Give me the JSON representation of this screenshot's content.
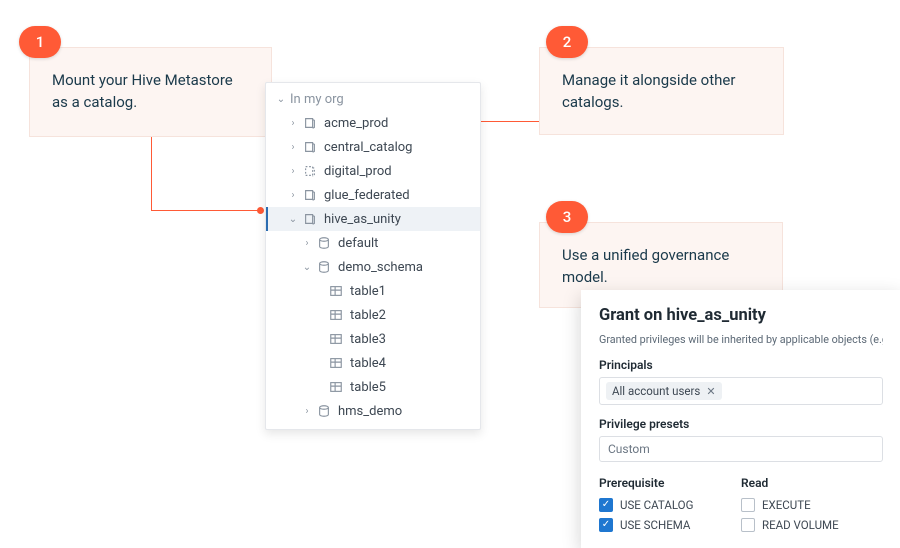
{
  "callouts": {
    "c1": {
      "num": "1",
      "text": "Mount your Hive Metastore as a catalog."
    },
    "c2": {
      "num": "2",
      "text": "Manage it alongside other catalogs."
    },
    "c3": {
      "num": "3",
      "text": "Use a unified governance model."
    }
  },
  "tree": {
    "root": "In my org",
    "items": {
      "acme_prod": "acme_prod",
      "central_catalog": "central_catalog",
      "digital_prod": "digital_prod",
      "glue_federated": "glue_federated",
      "hive_as_unity": "hive_as_unity",
      "default": "default",
      "demo_schema": "demo_schema",
      "table1": "table1",
      "table2": "table2",
      "table3": "table3",
      "table4": "table4",
      "table5": "table5",
      "hms_demo": "hms_demo"
    }
  },
  "grant": {
    "title": "Grant on hive_as_unity",
    "subtitle": "Granted privileges will be inherited by applicable objects (e.g. schema",
    "principals_label": "Principals",
    "principal_chip": "All account users",
    "presets_label": "Privilege presets",
    "preset_value": "Custom",
    "columns": {
      "prerequisite": "Prerequisite",
      "read": "Read"
    },
    "privs": {
      "use_catalog": "USE CATALOG",
      "use_schema": "USE SCHEMA",
      "execute": "EXECUTE",
      "read_volume": "READ VOLUME"
    }
  }
}
